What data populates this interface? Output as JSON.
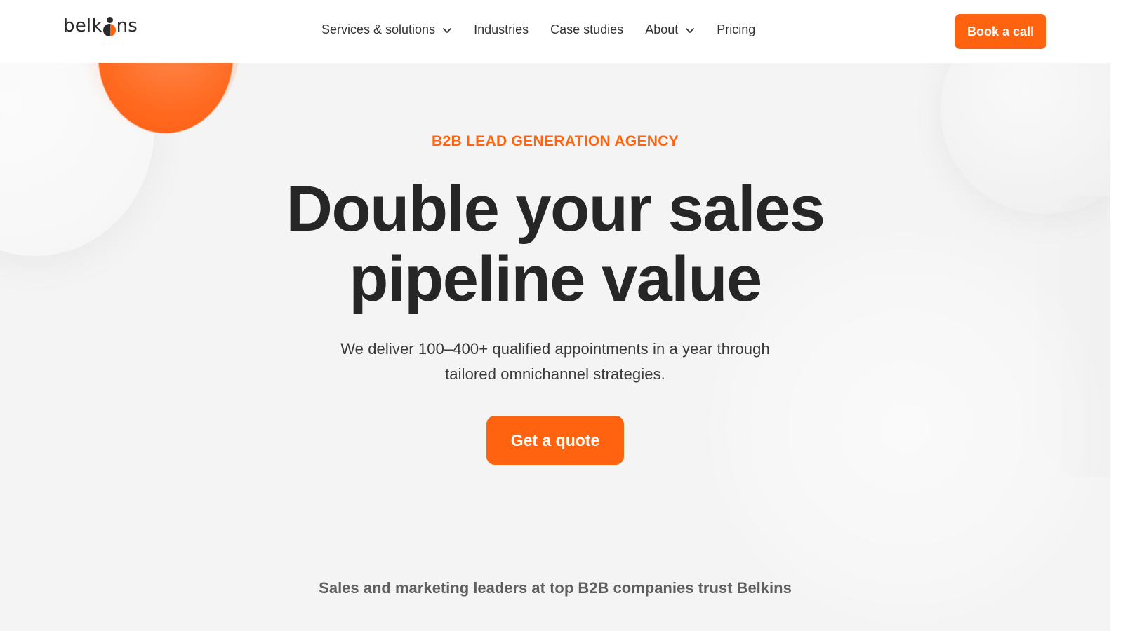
{
  "header": {
    "logo_text_left": "belk",
    "logo_text_right": "ns",
    "nav": [
      {
        "label": "Services & solutions",
        "has_dropdown": true
      },
      {
        "label": "Industries",
        "has_dropdown": false
      },
      {
        "label": "Case studies",
        "has_dropdown": false
      },
      {
        "label": "About",
        "has_dropdown": true
      },
      {
        "label": "Pricing",
        "has_dropdown": false
      }
    ],
    "cta_label": "Book a call"
  },
  "hero": {
    "eyebrow": "B2B LEAD GENERATION AGENCY",
    "headline_line1": "Double your sales",
    "headline_line2": "pipeline value",
    "subhead_line1": "We deliver 100–400+ qualified appointments in a year through",
    "subhead_line2": "tailored omnichannel strategies.",
    "cta_label": "Get a quote"
  },
  "trust": {
    "text": "Sales and marketing leaders at top B2B companies trust Belkins"
  },
  "colors": {
    "accent": "#ff6310",
    "text_dark": "#262626",
    "background": "#f4f4f4"
  },
  "icons": {
    "dropdown": "chevron-down-icon"
  }
}
